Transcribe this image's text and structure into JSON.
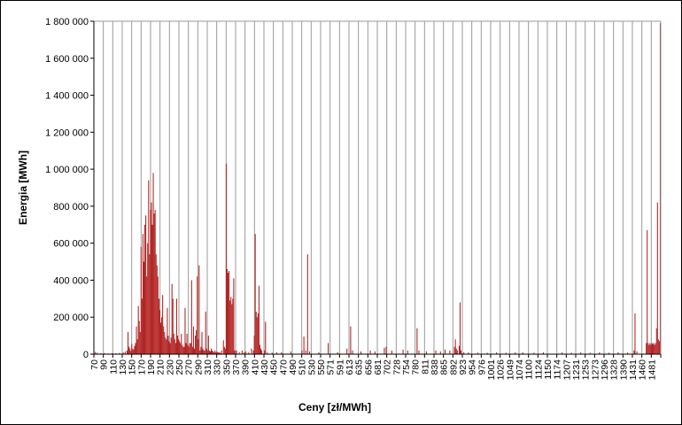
{
  "chart_data": {
    "type": "bar",
    "title": "",
    "xlabel": "Ceny [zł/MWh]",
    "ylabel": "Energia [MWh]",
    "ylim": [
      0,
      1800000
    ],
    "y_ticks": [
      "0",
      "200 000",
      "400 000",
      "600 000",
      "800 000",
      "1 000 000",
      "1 200 000",
      "1 400 000",
      "1 600 000",
      "1 800 000"
    ],
    "x_tick_labels": [
      "70",
      "90",
      "110",
      "130",
      "150",
      "170",
      "190",
      "210",
      "230",
      "250",
      "270",
      "290",
      "310",
      "330",
      "350",
      "370",
      "390",
      "410",
      "430",
      "450",
      "470",
      "490",
      "510",
      "530",
      "550",
      "571",
      "591",
      "613",
      "635",
      "656",
      "681",
      "702",
      "728",
      "754",
      "780",
      "811",
      "838",
      "865",
      "892",
      "923",
      "954",
      "976",
      "1001",
      "1026",
      "1049",
      "1074",
      "1100",
      "1124",
      "1150",
      "1174",
      "1207",
      "1231",
      "1253",
      "1273",
      "1296",
      "1328",
      "1390",
      "1431",
      "1460",
      "1481"
    ],
    "grid": true,
    "legend": "none",
    "bar_color": "#B22222",
    "series": [
      {
        "values": [
          [
            1,
            12000
          ],
          [
            3,
            8000
          ],
          [
            7,
            5000
          ],
          [
            11,
            6000
          ],
          [
            15,
            4000
          ],
          [
            19,
            5000
          ],
          [
            23,
            5000
          ],
          [
            27,
            7000
          ],
          [
            31,
            9000
          ],
          [
            33,
            15000
          ],
          [
            35,
            20000
          ],
          [
            36,
            120000
          ],
          [
            37,
            40000
          ],
          [
            38,
            30000
          ],
          [
            39,
            18000
          ],
          [
            40,
            55000
          ],
          [
            41,
            30000
          ],
          [
            42,
            25000
          ],
          [
            43,
            45000
          ],
          [
            44,
            60000
          ],
          [
            45,
            150000
          ],
          [
            46,
            80000
          ],
          [
            47,
            260000
          ],
          [
            48,
            180000
          ],
          [
            49,
            120000
          ],
          [
            50,
            580000
          ],
          [
            51,
            300000
          ],
          [
            52,
            650000
          ],
          [
            53,
            500000
          ],
          [
            54,
            700000
          ],
          [
            55,
            750000
          ],
          [
            56,
            420000
          ],
          [
            57,
            600000
          ],
          [
            58,
            940000
          ],
          [
            59,
            540000
          ],
          [
            60,
            780000
          ],
          [
            61,
            820000
          ],
          [
            62,
            700000
          ],
          [
            63,
            980000
          ],
          [
            64,
            760000
          ],
          [
            65,
            780000
          ],
          [
            66,
            540000
          ],
          [
            67,
            480000
          ],
          [
            68,
            420000
          ],
          [
            69,
            300000
          ],
          [
            70,
            240000
          ],
          [
            71,
            170000
          ],
          [
            72,
            200000
          ],
          [
            73,
            320000
          ],
          [
            74,
            150000
          ],
          [
            75,
            120000
          ],
          [
            76,
            90000
          ],
          [
            77,
            80000
          ],
          [
            78,
            250000
          ],
          [
            79,
            100000
          ],
          [
            80,
            70000
          ],
          [
            81,
            60000
          ],
          [
            82,
            90000
          ],
          [
            83,
            380000
          ],
          [
            84,
            300000
          ],
          [
            85,
            110000
          ],
          [
            86,
            80000
          ],
          [
            87,
            60000
          ],
          [
            88,
            300000
          ],
          [
            89,
            100000
          ],
          [
            90,
            80000
          ],
          [
            91,
            70000
          ],
          [
            92,
            60000
          ],
          [
            93,
            110000
          ],
          [
            94,
            50000
          ],
          [
            95,
            40000
          ],
          [
            96,
            40000
          ],
          [
            97,
            250000
          ],
          [
            98,
            60000
          ],
          [
            99,
            110000
          ],
          [
            100,
            50000
          ],
          [
            101,
            40000
          ],
          [
            102,
            60000
          ],
          [
            103,
            60000
          ],
          [
            104,
            400000
          ],
          [
            105,
            40000
          ],
          [
            106,
            150000
          ],
          [
            107,
            30000
          ],
          [
            108,
            100000
          ],
          [
            109,
            130000
          ],
          [
            110,
            420000
          ],
          [
            111,
            80000
          ],
          [
            112,
            480000
          ],
          [
            113,
            20000
          ],
          [
            114,
            40000
          ],
          [
            115,
            120000
          ],
          [
            116,
            30000
          ],
          [
            117,
            20000
          ],
          [
            118,
            20000
          ],
          [
            119,
            230000
          ],
          [
            120,
            30000
          ],
          [
            121,
            20000
          ],
          [
            122,
            100000
          ],
          [
            123,
            20000
          ],
          [
            124,
            15000
          ],
          [
            125,
            30000
          ],
          [
            126,
            20000
          ],
          [
            127,
            15000
          ],
          [
            128,
            10000
          ],
          [
            129,
            20000
          ],
          [
            130,
            10000
          ],
          [
            131,
            15000
          ],
          [
            132,
            10000
          ],
          [
            133,
            8000
          ],
          [
            134,
            10000
          ],
          [
            135,
            5000
          ],
          [
            136,
            20000
          ],
          [
            138,
            75000
          ],
          [
            139,
            40000
          ],
          [
            140,
            30000
          ],
          [
            141,
            1030000
          ],
          [
            142,
            460000
          ],
          [
            143,
            440000
          ],
          [
            144,
            450000
          ],
          [
            145,
            290000
          ],
          [
            146,
            310000
          ],
          [
            147,
            270000
          ],
          [
            148,
            300000
          ],
          [
            149,
            410000
          ],
          [
            150,
            20000
          ],
          [
            152,
            20000
          ],
          [
            155,
            10000
          ],
          [
            158,
            20000
          ],
          [
            160,
            10000
          ],
          [
            162,
            15000
          ],
          [
            165,
            10000
          ],
          [
            168,
            30000
          ],
          [
            170,
            20000
          ],
          [
            171,
            100000
          ],
          [
            172,
            650000
          ],
          [
            173,
            230000
          ],
          [
            174,
            200000
          ],
          [
            175,
            220000
          ],
          [
            176,
            370000
          ],
          [
            177,
            50000
          ],
          [
            178,
            30000
          ],
          [
            179,
            20000
          ],
          [
            182,
            20000
          ],
          [
            183,
            175000
          ],
          [
            185,
            10000
          ],
          [
            190,
            8000
          ],
          [
            195,
            10000
          ],
          [
            200,
            10000
          ],
          [
            210,
            15000
          ],
          [
            222,
            20000
          ],
          [
            224,
            95000
          ],
          [
            226,
            20000
          ],
          [
            228,
            540000
          ],
          [
            230,
            15000
          ],
          [
            240,
            10000
          ],
          [
            250,
            60000
          ],
          [
            260,
            10000
          ],
          [
            270,
            30000
          ],
          [
            274,
            150000
          ],
          [
            276,
            20000
          ],
          [
            285,
            15000
          ],
          [
            295,
            20000
          ],
          [
            300,
            15000
          ],
          [
            310,
            35000
          ],
          [
            312,
            40000
          ],
          [
            318,
            20000
          ],
          [
            330,
            25000
          ],
          [
            335,
            20000
          ],
          [
            345,
            140000
          ],
          [
            347,
            20000
          ],
          [
            355,
            15000
          ],
          [
            365,
            20000
          ],
          [
            370,
            15000
          ],
          [
            375,
            25000
          ],
          [
            380,
            20000
          ],
          [
            385,
            40000
          ],
          [
            386,
            80000
          ],
          [
            387,
            30000
          ],
          [
            388,
            20000
          ],
          [
            390,
            45000
          ],
          [
            391,
            280000
          ],
          [
            392,
            20000
          ],
          [
            395,
            10000
          ],
          [
            400,
            10000
          ],
          [
            410,
            8000
          ],
          [
            420,
            8000
          ],
          [
            430,
            10000
          ],
          [
            440,
            8000
          ],
          [
            450,
            10000
          ],
          [
            458,
            10000
          ],
          [
            470,
            8000
          ],
          [
            480,
            10000
          ],
          [
            500,
            10000
          ],
          [
            510,
            8000
          ],
          [
            520,
            10000
          ],
          [
            530,
            8000
          ],
          [
            540,
            10000
          ],
          [
            550,
            8000
          ],
          [
            560,
            10000
          ],
          [
            570,
            8000
          ],
          [
            577,
            20000
          ],
          [
            578,
            220000
          ],
          [
            580,
            15000
          ],
          [
            590,
            60000
          ],
          [
            591,
            670000
          ],
          [
            592,
            60000
          ],
          [
            593,
            50000
          ],
          [
            594,
            60000
          ],
          [
            595,
            50000
          ],
          [
            596,
            60000
          ],
          [
            597,
            55000
          ],
          [
            598,
            60000
          ],
          [
            599,
            50000
          ],
          [
            600,
            60000
          ],
          [
            601,
            140000
          ],
          [
            602,
            820000
          ],
          [
            603,
            80000
          ],
          [
            604,
            70000
          ],
          [
            605,
            1790000
          ]
        ]
      }
    ]
  }
}
